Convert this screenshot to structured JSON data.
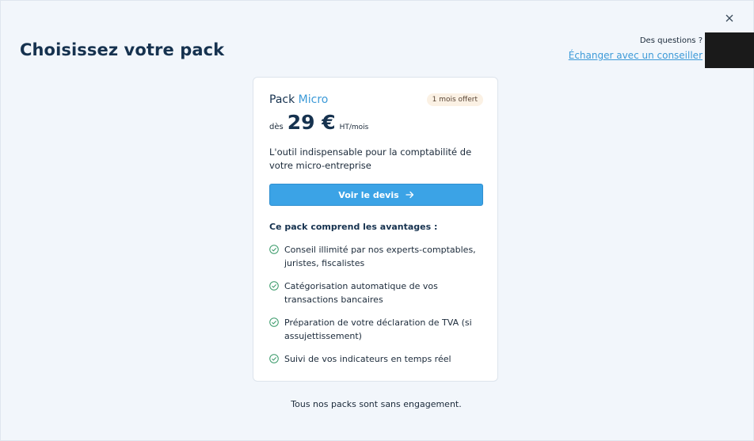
{
  "header": {
    "title": "Choisissez votre pack",
    "help_question": "Des questions ?",
    "help_link": "Échanger avec un conseiller"
  },
  "card": {
    "pack_prefix": "Pack",
    "pack_name": "Micro",
    "badge": "1 mois offert",
    "price_prefix": "dès",
    "price": "29 €",
    "price_suffix": "HT/mois",
    "description": "L'outil indispensable pour la comptabilité de votre micro-entreprise",
    "cta_label": "Voir le devis",
    "advantages_title": "Ce pack comprend les avantages :",
    "advantages": [
      "Conseil illimité par nos experts-comptables, juristes, fiscalistes",
      "Catégorisation automatique de vos transactions bancaires",
      "Préparation de votre déclaration de TVA (si assujettissement)",
      "Suivi de vos indicateurs en temps réel"
    ]
  },
  "footer": {
    "note": "Tous nos packs sont sans engagement."
  },
  "icons": {
    "close": "close-icon",
    "arrow": "arrow-right-icon",
    "check": "check-circle-icon"
  },
  "colors": {
    "accent": "#3c9ad8",
    "button": "#3ba3e6",
    "title": "#16324f",
    "check": "#3a9a6a",
    "badge_bg": "#fbf1e4"
  }
}
